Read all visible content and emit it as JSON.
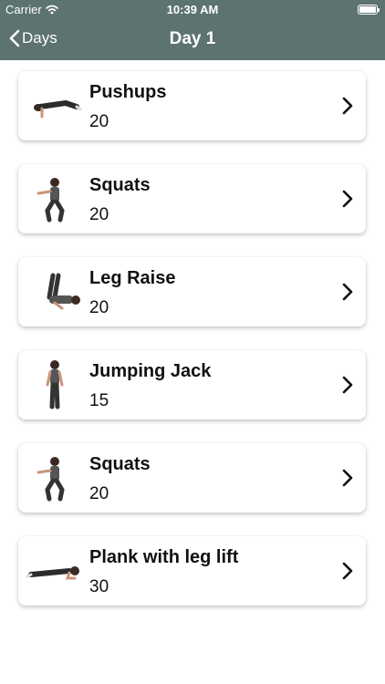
{
  "status_bar": {
    "carrier": "Carrier",
    "time": "10:39 AM",
    "battery_level": 1.0
  },
  "nav": {
    "back_label": "Days",
    "title": "Day 1"
  },
  "colors": {
    "nav_background": "#5c7370",
    "card_background": "#ffffff",
    "text": "#111111"
  },
  "exercises": [
    {
      "name": "Pushups",
      "reps": "20",
      "icon": "pushup-figure"
    },
    {
      "name": "Squats",
      "reps": "20",
      "icon": "squat-figure"
    },
    {
      "name": "Leg Raise",
      "reps": "20",
      "icon": "leg-raise-figure"
    },
    {
      "name": "Jumping Jack",
      "reps": "15",
      "icon": "jumping-jack-figure"
    },
    {
      "name": "Squats",
      "reps": "20",
      "icon": "squat-figure"
    },
    {
      "name": "Plank with leg lift",
      "reps": "30",
      "icon": "plank-figure"
    }
  ]
}
